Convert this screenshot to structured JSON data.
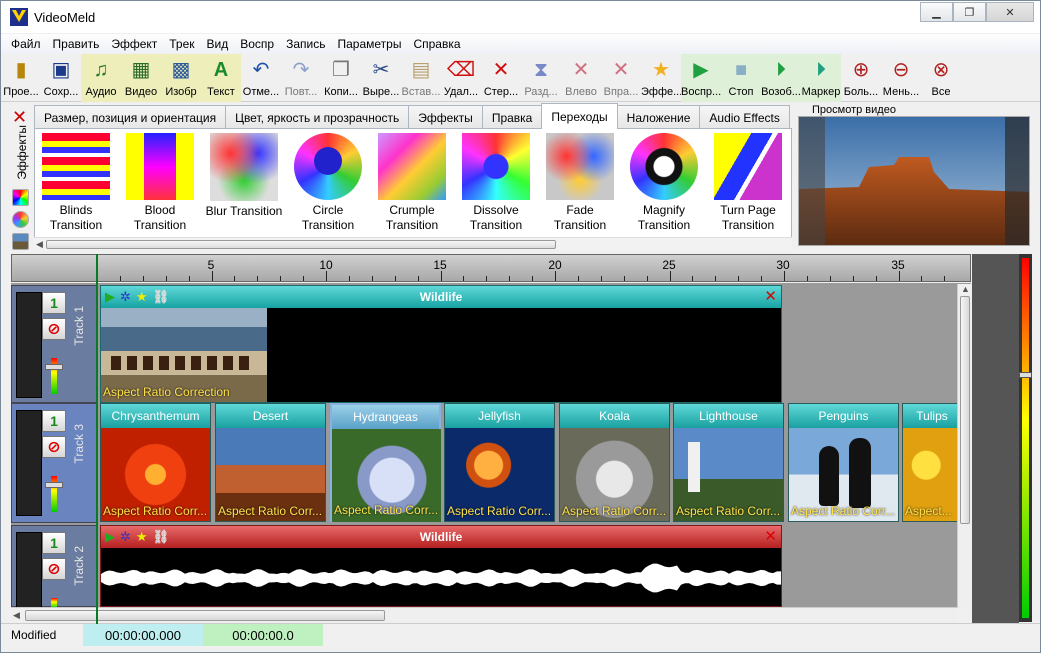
{
  "window": {
    "title": "VideoMeld"
  },
  "menu": [
    "Файл",
    "Править",
    "Эффект",
    "Трек",
    "Вид",
    "Воспр",
    "Запись",
    "Параметры",
    "Справка"
  ],
  "toolbar": [
    {
      "label": "Прое...",
      "icon": "project-icon",
      "group": ""
    },
    {
      "label": "Сохр...",
      "icon": "save-icon",
      "group": ""
    },
    {
      "label": "Аудио",
      "icon": "add-audio-icon",
      "group": "y"
    },
    {
      "label": "Видео",
      "icon": "add-video-icon",
      "group": "y"
    },
    {
      "label": "Изобр",
      "icon": "add-image-icon",
      "group": "y"
    },
    {
      "label": "Текст",
      "icon": "add-text-icon",
      "group": "y"
    },
    {
      "label": "Отме...",
      "icon": "undo-icon",
      "group": ""
    },
    {
      "label": "Повт...",
      "icon": "redo-icon",
      "group": "",
      "disabled": true
    },
    {
      "label": "Копи...",
      "icon": "copy-icon",
      "group": ""
    },
    {
      "label": "Выре...",
      "icon": "cut-icon",
      "group": ""
    },
    {
      "label": "Встав...",
      "icon": "paste-icon",
      "group": "",
      "disabled": true
    },
    {
      "label": "Удал...",
      "icon": "delete-icon",
      "group": ""
    },
    {
      "label": "Стер...",
      "icon": "erase-icon",
      "group": ""
    },
    {
      "label": "Разд...",
      "icon": "split-icon",
      "group": "",
      "disabled": true
    },
    {
      "label": "Влево",
      "icon": "move-left-icon",
      "group": "",
      "disabled": true
    },
    {
      "label": "Впра...",
      "icon": "move-right-icon",
      "group": "",
      "disabled": true
    },
    {
      "label": "Эффе...",
      "icon": "effect-star-icon",
      "group": ""
    },
    {
      "label": "Воспр...",
      "icon": "play-icon",
      "group": "g"
    },
    {
      "label": "Стоп",
      "icon": "stop-icon",
      "group": "g"
    },
    {
      "label": "Возоб...",
      "icon": "resume-icon",
      "group": "g"
    },
    {
      "label": "Маркер",
      "icon": "marker-icon",
      "group": "g"
    },
    {
      "label": "Боль...",
      "icon": "zoom-in-icon",
      "group": ""
    },
    {
      "label": "Мень...",
      "icon": "zoom-out-icon",
      "group": ""
    },
    {
      "label": "Все",
      "icon": "zoom-all-icon",
      "group": ""
    }
  ],
  "side_panel": {
    "label": "Эффекты"
  },
  "tabs": [
    {
      "label": "Размер, позиция и ориентация",
      "active": false
    },
    {
      "label": "Цвет, яркость и прозрачность",
      "active": false
    },
    {
      "label": "Эффекты",
      "active": false
    },
    {
      "label": "Правка",
      "active": false
    },
    {
      "label": "Переходы",
      "active": true
    },
    {
      "label": "Наложение",
      "active": false
    },
    {
      "label": "Audio Effects",
      "active": false
    }
  ],
  "effects": [
    {
      "line1": "Blinds",
      "line2": "Transition"
    },
    {
      "line1": "Blood",
      "line2": "Transition"
    },
    {
      "line1": "Blur Transition",
      "line2": ""
    },
    {
      "line1": "Circle",
      "line2": "Transition"
    },
    {
      "line1": "Crumple",
      "line2": "Transition"
    },
    {
      "line1": "Dissolve",
      "line2": "Transition"
    },
    {
      "line1": "Fade",
      "line2": "Transition"
    },
    {
      "line1": "Magnify",
      "line2": "Transition"
    },
    {
      "line1": "Turn Page",
      "line2": "Transition"
    }
  ],
  "preview": {
    "label": "Просмотр видео"
  },
  "ruler": {
    "ticks": [
      "5",
      "10",
      "15",
      "20",
      "25",
      "30",
      "35"
    ]
  },
  "tracks": [
    {
      "name": "Track 1",
      "mute_label": "1"
    },
    {
      "name": "Track 3",
      "mute_label": "1"
    },
    {
      "name": "Track 2",
      "mute_label": "1"
    }
  ],
  "video_clip": {
    "title": "Wildlife",
    "effect": "Aspect Ratio Correction"
  },
  "image_clips": [
    {
      "title": "Chrysanthemum",
      "effect": "Aspect Ratio Corr..."
    },
    {
      "title": "Desert",
      "effect": "Aspect Ratio Corr..."
    },
    {
      "title": "Hydrangeas",
      "effect": "Aspect Ratio Corr..."
    },
    {
      "title": "Jellyfish",
      "effect": "Aspect Ratio Corr..."
    },
    {
      "title": "Koala",
      "effect": "Aspect Ratio Corr..."
    },
    {
      "title": "Lighthouse",
      "effect": "Aspect Ratio Corr..."
    },
    {
      "title": "Penguins",
      "effect": "Aspect Ratio Corr..."
    },
    {
      "title": "Tulips",
      "effect": "Aspect..."
    }
  ],
  "audio_clip": {
    "title": "Wildlife"
  },
  "status": {
    "state": "Modified",
    "time1": "00:00:00.000",
    "time2": "00:00:00.0"
  }
}
